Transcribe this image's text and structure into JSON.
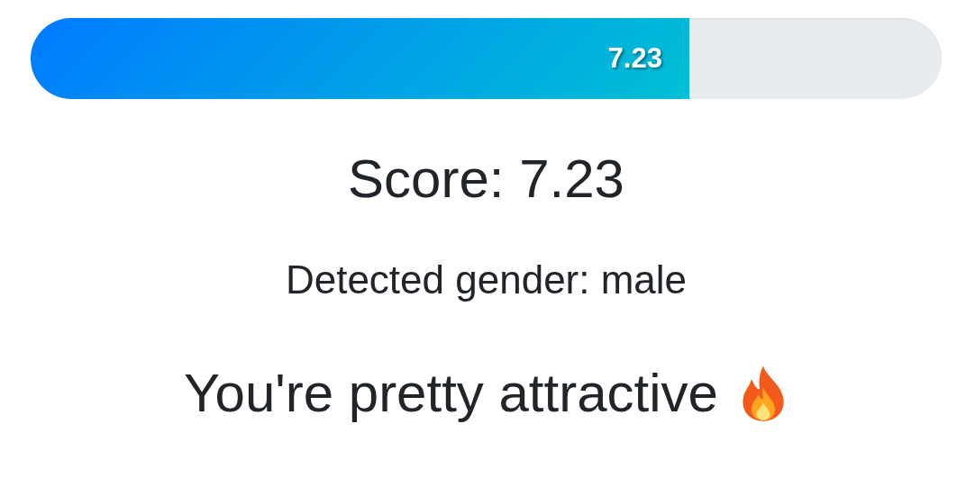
{
  "progress": {
    "level": 0.723,
    "label": "7.23"
  },
  "score": "Score: 7.23",
  "gender": "Detected gender: male",
  "verdict": "You're pretty attractive"
}
